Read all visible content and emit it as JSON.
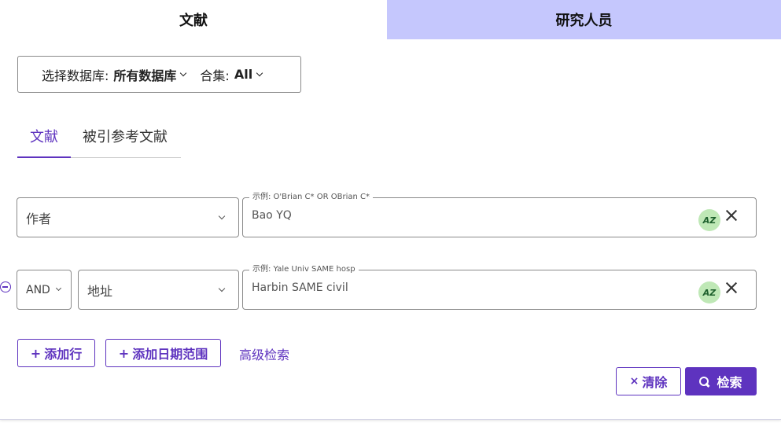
{
  "tabs": {
    "documents": "文献",
    "researchers": "研究人员"
  },
  "database": {
    "label": "选择数据库:",
    "value": "所有数据库",
    "collection_label": "合集:",
    "collection_value": "All"
  },
  "subtabs": {
    "documents": "文献",
    "cited": "被引参考文献"
  },
  "rows": [
    {
      "field": "作者",
      "hint": "示例: O'Brian C* OR OBrian C*",
      "value": "Bao YQ",
      "az": "AZ"
    },
    {
      "operator": "AND",
      "field": "地址",
      "hint": "示例: Yale Univ SAME hosp",
      "value": "Harbin SAME civil",
      "az": "AZ"
    }
  ],
  "actions": {
    "add_row": "添加行",
    "add_date": "添加日期范围",
    "advanced": "高级检索",
    "clear": "清除",
    "search": "检索",
    "plus": "+",
    "times": "×"
  },
  "colors": {
    "accent": "#5e33bf",
    "tab_inactive_bg": "#c5c7fd",
    "az_bg": "#bfe8b6"
  }
}
